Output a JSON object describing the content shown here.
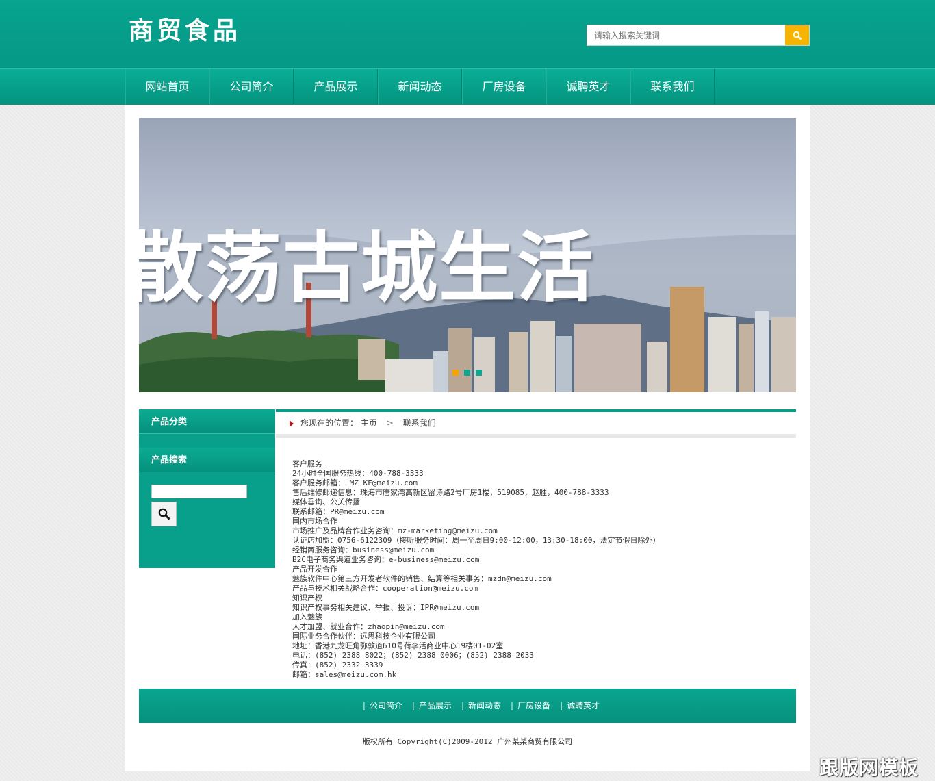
{
  "header": {
    "logo": "商贸食品",
    "search_placeholder": "请输入搜索关键词"
  },
  "nav": {
    "items": [
      "网站首页",
      "公司简介",
      "产品展示",
      "新闻动态",
      "厂房设备",
      "诚聘英才",
      "联系我们"
    ]
  },
  "banner": {
    "headline": "散荡古城生活",
    "dots": 3,
    "active_dot": 0,
    "colors": {
      "dot_active": "#f5a400",
      "dot_inactive": "#10a58f"
    }
  },
  "sidebar": {
    "category_title": "产品分类",
    "search_title": "产品搜索"
  },
  "breadcrumb": {
    "prefix": "您现在的位置：",
    "home": "主页",
    "sep": ">",
    "current": "联系我们"
  },
  "article": {
    "lines": [
      "客户服务",
      "24小时全国服务热线：400-788-3333",
      "客户服务邮箱： MZ_KF@meizu.com",
      "售后维修邮递信息：珠海市唐家湾高新区留诗路2号厂房1楼，519085，赵胜，400-788-3333",
      "媒体垂询、公关传播",
      "联系邮箱：PR@meizu.com",
      "国内市场合作",
      "市场推广及品牌合作业务咨询：mz-marketing@meizu.com",
      "认证店加盟：0756-6122309（接听服务时间：周一至周日9:00-12:00，13:30-18:00，法定节假日除外）",
      "经销商服务咨询：business@meizu.com",
      "B2C电子商务渠道业务咨询：e-business@meizu.com",
      "产品开发合作",
      "魅族软件中心第三方开发者软件的销售、结算等相关事务：mzdn@meizu.com",
      "产品与技术相关战略合作：cooperation@meizu.com",
      "知识产权",
      "知识产权事务相关建议、举报、投诉：IPR@meizu.com",
      "加入魅族",
      "人才加盟、就业合作：zhaopin@meizu.com",
      "国际业务合作伙伴：远思科技企业有限公司",
      "地址：香港九龙旺角弥敦道610号荷李活商业中心19楼01-02室",
      "电话：(852) 2388 8022；(852) 2388 0006；(852) 2388 2033",
      "传真：(852) 2332 3339",
      "邮箱：sales@meizu.com.hk"
    ]
  },
  "footer": {
    "links": [
      "公司简介",
      "产品展示",
      "新闻动态",
      "厂房设备",
      "诚聘英才"
    ],
    "copyright": "版权所有 Copyright(C)2009-2012 广州某某商贸有限公司"
  },
  "watermark": "跟版网模板"
}
